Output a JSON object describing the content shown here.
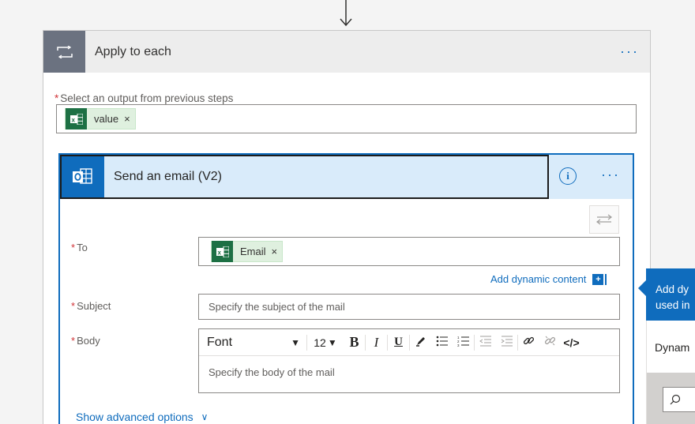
{
  "apply_to_each": {
    "title": "Apply to each",
    "menu": "···",
    "select_output_label": "Select an output from previous steps",
    "token_label": "value",
    "token_remove": "×"
  },
  "send_email": {
    "title": "Send an email (V2)",
    "info_icon": "i",
    "menu": "···",
    "to_label": "To",
    "to_token_label": "Email",
    "to_token_remove": "×",
    "add_dynamic_content": "Add dynamic content",
    "subject_label": "Subject",
    "subject_placeholder": "Specify the subject of the mail",
    "body_label": "Body",
    "toolbar": {
      "font": "Font",
      "font_caret": "▼",
      "size": "12",
      "size_caret": "▼",
      "bold": "B",
      "italic": "I",
      "underline": "U",
      "code": "</>"
    },
    "body_placeholder": "Specify the body of the mail",
    "show_advanced": "Show advanced options",
    "show_advanced_chevron": "∨"
  },
  "dynamic_panel": {
    "text_line1": "Add dy",
    "text_line2": "used in",
    "tab_label": "Dynam"
  },
  "required_marker": "*",
  "colors": {
    "accent": "#0f6cbd",
    "excel_green": "#1d7044",
    "required": "#d13438"
  }
}
